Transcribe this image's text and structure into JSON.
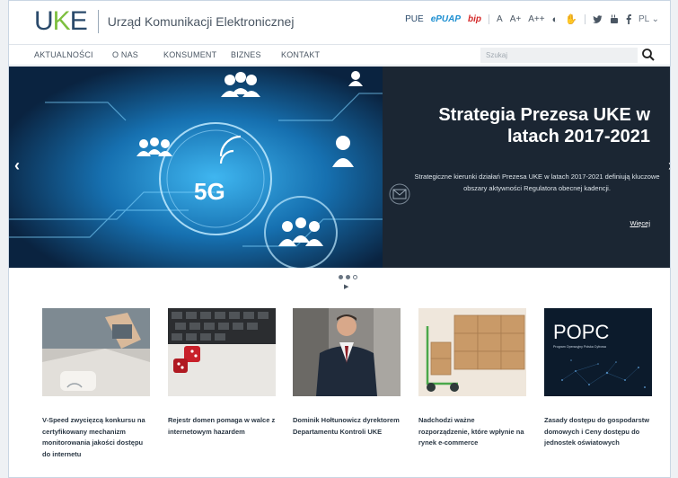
{
  "header": {
    "logo_letters": "UKE",
    "site_name": "Urząd Komunikacji Elektronicznej",
    "links": {
      "pue": "PUE",
      "epuap": "ePUAP",
      "bip": "bip"
    },
    "font_sizes": [
      "A",
      "A+",
      "A++"
    ],
    "language": "PL"
  },
  "nav": {
    "items": [
      "AKTUALNOŚCI",
      "O NAS",
      "KONSUMENT",
      "BIZNES",
      "KONTAKT"
    ],
    "search_placeholder": "Szukaj"
  },
  "hero": {
    "title": "Strategia Prezesa UKE w latach 2017-2021",
    "description": "Strategiczne kierunki działań Prezesa UKE w latach 2017-2021 definiują kluczowe obszary aktywności Regulatora obecnej kadencji.",
    "more_label": "Więcej",
    "badge_text": "5G",
    "slide_count": 3,
    "active_slide": 1
  },
  "news": [
    {
      "caption": "V-Speed zwycięzcą konkursu na certyfikowany mechanizm monitorowania jakości dostępu do internetu"
    },
    {
      "caption": "Rejestr domen pomaga w walce z internetowym hazardem"
    },
    {
      "caption": "Dominik Hołtunowicz dyrektorem Departamentu Kontroli UKE"
    },
    {
      "caption": "Nadchodzi ważne rozporządzenie, które wpłynie na rynek e-commerce"
    },
    {
      "caption": "Zasady dostępu do gospodarstw domowych i Ceny dostępu do jednostek oświatowych",
      "thumb_text": "POPC",
      "thumb_subtext": "Program Operacyjny Polska Cyfrowa"
    }
  ],
  "colors": {
    "brand_dark": "#2a4a6b",
    "brand_green": "#7dbf3f",
    "hero_panel": "#1b2633"
  }
}
